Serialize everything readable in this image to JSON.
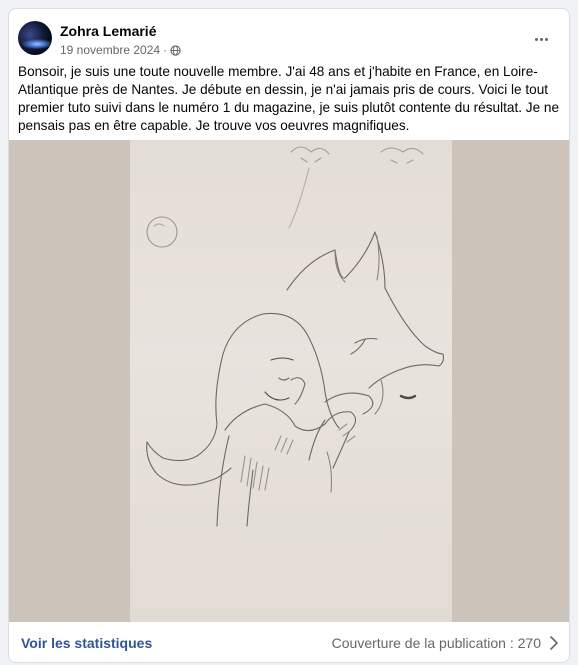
{
  "post": {
    "author": "Zohra Lemarié",
    "date": "19 novembre 2024",
    "separator": "·",
    "visibility_icon": "globe-icon",
    "more_icon": "more-options-icon",
    "text": "Bonsoir, je suis une toute nouvelle membre. J'ai 48 ans et j'habite en France, en Loire-Atlantique près de Nantes. Je débute en dessin, je n'ai jamais pris de cours. Voici le tout premier tuto suivi dans le numéro 1 du magazine, je suis plutôt contente du résultat. Je ne pensais pas en être capable. Je trouve vos oeuvres magnifiques."
  },
  "footer": {
    "stats_link": "Voir les statistiques",
    "reach": "Couverture de la publication : 270",
    "chevron_icon": "chevron-right-icon"
  },
  "colors": {
    "link": "#2f5597",
    "secondary_text": "#65676b",
    "photo_background": "#ccc4bb",
    "paper": "#e6e0da"
  }
}
